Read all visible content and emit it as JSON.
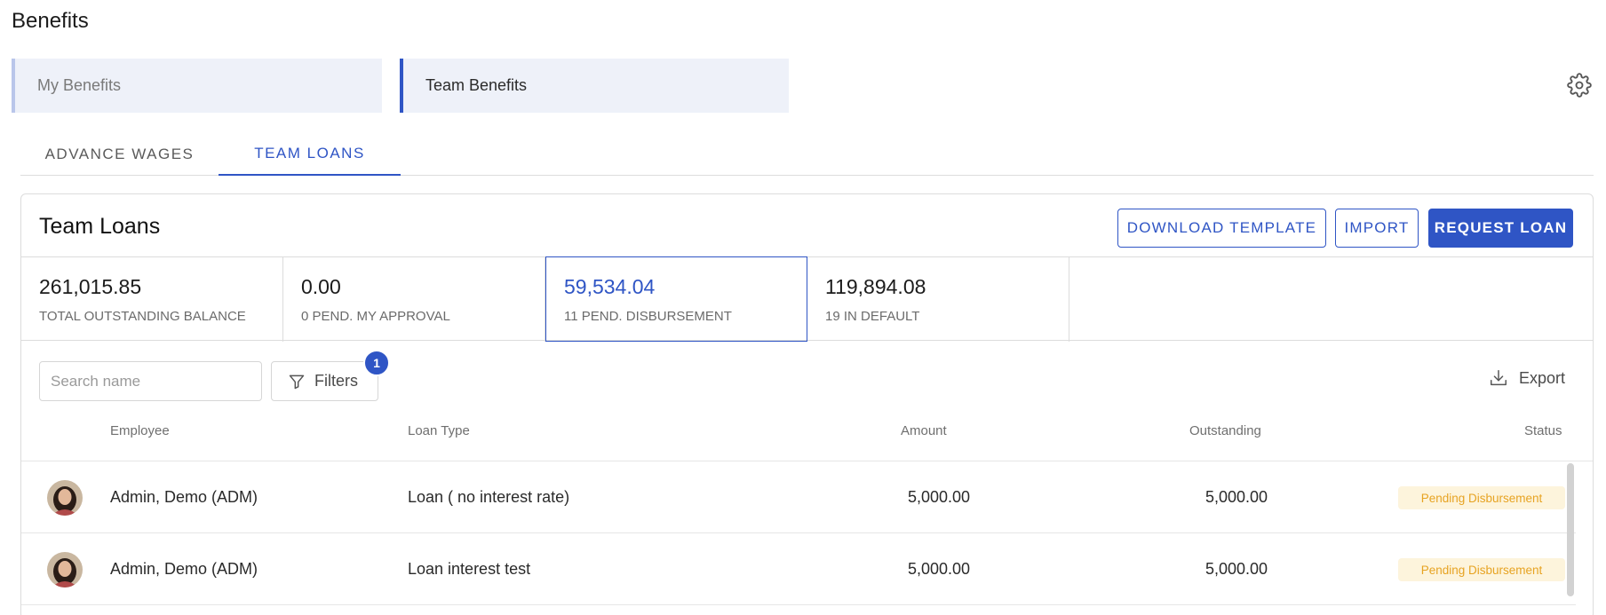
{
  "page": {
    "title": "Benefits"
  },
  "benefit_tabs": [
    {
      "label": "My Benefits"
    },
    {
      "label": "Team Benefits"
    }
  ],
  "sub_tabs": [
    {
      "label": "ADVANCE WAGES"
    },
    {
      "label": "TEAM LOANS"
    }
  ],
  "card": {
    "title": "Team Loans",
    "buttons": {
      "download": "DOWNLOAD TEMPLATE",
      "import": "IMPORT",
      "request": "REQUEST LOAN"
    }
  },
  "stats": [
    {
      "value": "261,015.85",
      "label": "TOTAL OUTSTANDING BALANCE"
    },
    {
      "value": "0.00",
      "label": "0 PEND. MY APPROVAL"
    },
    {
      "value": "59,534.04",
      "label": "11 PEND. DISBURSEMENT"
    },
    {
      "value": "119,894.08",
      "label": "19 IN DEFAULT"
    }
  ],
  "toolbar": {
    "search_placeholder": "Search name",
    "filters_label": "Filters",
    "filters_count": "1",
    "export_label": "Export"
  },
  "table": {
    "headers": {
      "employee": "Employee",
      "loan_type": "Loan Type",
      "amount": "Amount",
      "outstanding": "Outstanding",
      "status": "Status"
    },
    "rows": [
      {
        "employee": "Admin, Demo (ADM)",
        "loan_type": "Loan ( no interest rate)",
        "amount": "5,000.00",
        "outstanding": "5,000.00",
        "status": "Pending Disbursement"
      },
      {
        "employee": "Admin, Demo (ADM)",
        "loan_type": "Loan interest test",
        "amount": "5,000.00",
        "outstanding": "5,000.00",
        "status": "Pending Disbursement"
      }
    ]
  },
  "colors": {
    "accent": "#2f55c5",
    "status_pending_bg": "#fdf4dc",
    "status_pending_text": "#e7a322"
  },
  "icons": {
    "settings": "gear-icon",
    "filter": "filter-icon",
    "export": "download-icon"
  }
}
